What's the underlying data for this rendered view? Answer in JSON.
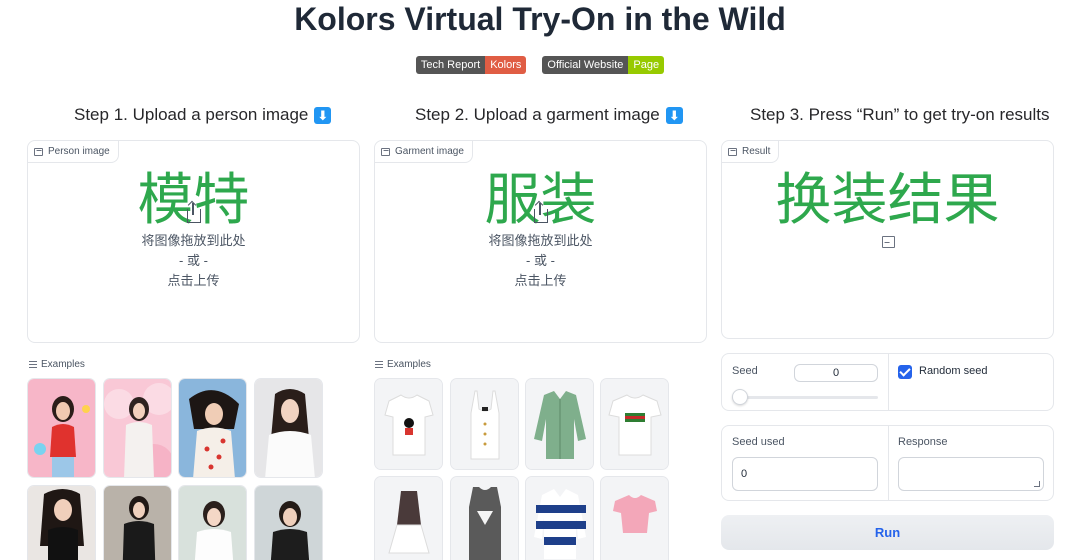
{
  "page": {
    "title": "Kolors Virtual Try-On in the Wild"
  },
  "badges": [
    {
      "left": "Tech Report",
      "right": "Kolors",
      "right_color": "#e05d44"
    },
    {
      "left": "Official Website",
      "right": "Page",
      "right_color": "#97ca00"
    }
  ],
  "steps": {
    "step1": "Step 1. Upload a person image",
    "step2": "Step 2. Upload a garment image",
    "step3": "Step 3. Press “Run” to get try-on results",
    "arrow_glyph": "⬇"
  },
  "person_panel": {
    "label": "Person image",
    "overlay_text": "模特",
    "drop_text": "将图像拖放到此处",
    "or_text": "- 或 -",
    "click_text": "点击上传"
  },
  "garment_panel": {
    "label": "Garment image",
    "overlay_text": "服装",
    "drop_text": "将图像拖放到此处",
    "or_text": "- 或 -",
    "click_text": "点击上传"
  },
  "result_panel": {
    "label": "Result",
    "overlay_text": "换装结果"
  },
  "examples_label": "Examples",
  "person_examples": [
    "model-red-top",
    "model-pink-clouds",
    "model-strawberry-dress",
    "model-white-blouse",
    "model-black-dress",
    "model-black-outfit",
    "model-white-shirt",
    "model-black-top"
  ],
  "garment_examples": [
    "white-tshirt-minnie",
    "white-tank-top",
    "green-denim-jacket",
    "gucci-white-tshirt",
    "black-white-dress",
    "gray-guess-tank",
    "striped-rugby-shirt",
    "pink-crop-top"
  ],
  "seed": {
    "label": "Seed",
    "value": "0",
    "random_label": "Random seed",
    "random_checked": true
  },
  "seed_used": {
    "label": "Seed used",
    "value": "0"
  },
  "response": {
    "label": "Response",
    "value": ""
  },
  "run_button": "Run",
  "colors": {
    "accent": "#2563eb",
    "overlay_green": "#2ea84d",
    "arrow_blue": "#2196f3"
  }
}
